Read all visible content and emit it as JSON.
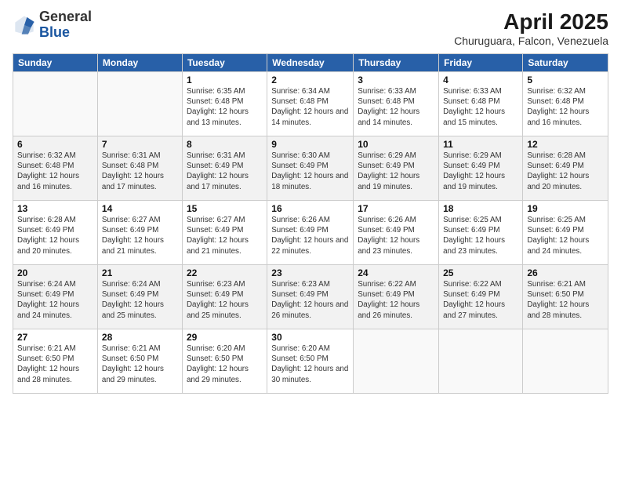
{
  "logo": {
    "general": "General",
    "blue": "Blue"
  },
  "title": {
    "month": "April 2025",
    "location": "Churuguara, Falcon, Venezuela"
  },
  "weekdays": [
    "Sunday",
    "Monday",
    "Tuesday",
    "Wednesday",
    "Thursday",
    "Friday",
    "Saturday"
  ],
  "rows": [
    [
      {
        "day": "",
        "sunrise": "",
        "sunset": "",
        "daylight": ""
      },
      {
        "day": "",
        "sunrise": "",
        "sunset": "",
        "daylight": ""
      },
      {
        "day": "1",
        "sunrise": "Sunrise: 6:35 AM",
        "sunset": "Sunset: 6:48 PM",
        "daylight": "Daylight: 12 hours and 13 minutes."
      },
      {
        "day": "2",
        "sunrise": "Sunrise: 6:34 AM",
        "sunset": "Sunset: 6:48 PM",
        "daylight": "Daylight: 12 hours and 14 minutes."
      },
      {
        "day": "3",
        "sunrise": "Sunrise: 6:33 AM",
        "sunset": "Sunset: 6:48 PM",
        "daylight": "Daylight: 12 hours and 14 minutes."
      },
      {
        "day": "4",
        "sunrise": "Sunrise: 6:33 AM",
        "sunset": "Sunset: 6:48 PM",
        "daylight": "Daylight: 12 hours and 15 minutes."
      },
      {
        "day": "5",
        "sunrise": "Sunrise: 6:32 AM",
        "sunset": "Sunset: 6:48 PM",
        "daylight": "Daylight: 12 hours and 16 minutes."
      }
    ],
    [
      {
        "day": "6",
        "sunrise": "Sunrise: 6:32 AM",
        "sunset": "Sunset: 6:48 PM",
        "daylight": "Daylight: 12 hours and 16 minutes."
      },
      {
        "day": "7",
        "sunrise": "Sunrise: 6:31 AM",
        "sunset": "Sunset: 6:48 PM",
        "daylight": "Daylight: 12 hours and 17 minutes."
      },
      {
        "day": "8",
        "sunrise": "Sunrise: 6:31 AM",
        "sunset": "Sunset: 6:49 PM",
        "daylight": "Daylight: 12 hours and 17 minutes."
      },
      {
        "day": "9",
        "sunrise": "Sunrise: 6:30 AM",
        "sunset": "Sunset: 6:49 PM",
        "daylight": "Daylight: 12 hours and 18 minutes."
      },
      {
        "day": "10",
        "sunrise": "Sunrise: 6:29 AM",
        "sunset": "Sunset: 6:49 PM",
        "daylight": "Daylight: 12 hours and 19 minutes."
      },
      {
        "day": "11",
        "sunrise": "Sunrise: 6:29 AM",
        "sunset": "Sunset: 6:49 PM",
        "daylight": "Daylight: 12 hours and 19 minutes."
      },
      {
        "day": "12",
        "sunrise": "Sunrise: 6:28 AM",
        "sunset": "Sunset: 6:49 PM",
        "daylight": "Daylight: 12 hours and 20 minutes."
      }
    ],
    [
      {
        "day": "13",
        "sunrise": "Sunrise: 6:28 AM",
        "sunset": "Sunset: 6:49 PM",
        "daylight": "Daylight: 12 hours and 20 minutes."
      },
      {
        "day": "14",
        "sunrise": "Sunrise: 6:27 AM",
        "sunset": "Sunset: 6:49 PM",
        "daylight": "Daylight: 12 hours and 21 minutes."
      },
      {
        "day": "15",
        "sunrise": "Sunrise: 6:27 AM",
        "sunset": "Sunset: 6:49 PM",
        "daylight": "Daylight: 12 hours and 21 minutes."
      },
      {
        "day": "16",
        "sunrise": "Sunrise: 6:26 AM",
        "sunset": "Sunset: 6:49 PM",
        "daylight": "Daylight: 12 hours and 22 minutes."
      },
      {
        "day": "17",
        "sunrise": "Sunrise: 6:26 AM",
        "sunset": "Sunset: 6:49 PM",
        "daylight": "Daylight: 12 hours and 23 minutes."
      },
      {
        "day": "18",
        "sunrise": "Sunrise: 6:25 AM",
        "sunset": "Sunset: 6:49 PM",
        "daylight": "Daylight: 12 hours and 23 minutes."
      },
      {
        "day": "19",
        "sunrise": "Sunrise: 6:25 AM",
        "sunset": "Sunset: 6:49 PM",
        "daylight": "Daylight: 12 hours and 24 minutes."
      }
    ],
    [
      {
        "day": "20",
        "sunrise": "Sunrise: 6:24 AM",
        "sunset": "Sunset: 6:49 PM",
        "daylight": "Daylight: 12 hours and 24 minutes."
      },
      {
        "day": "21",
        "sunrise": "Sunrise: 6:24 AM",
        "sunset": "Sunset: 6:49 PM",
        "daylight": "Daylight: 12 hours and 25 minutes."
      },
      {
        "day": "22",
        "sunrise": "Sunrise: 6:23 AM",
        "sunset": "Sunset: 6:49 PM",
        "daylight": "Daylight: 12 hours and 25 minutes."
      },
      {
        "day": "23",
        "sunrise": "Sunrise: 6:23 AM",
        "sunset": "Sunset: 6:49 PM",
        "daylight": "Daylight: 12 hours and 26 minutes."
      },
      {
        "day": "24",
        "sunrise": "Sunrise: 6:22 AM",
        "sunset": "Sunset: 6:49 PM",
        "daylight": "Daylight: 12 hours and 26 minutes."
      },
      {
        "day": "25",
        "sunrise": "Sunrise: 6:22 AM",
        "sunset": "Sunset: 6:49 PM",
        "daylight": "Daylight: 12 hours and 27 minutes."
      },
      {
        "day": "26",
        "sunrise": "Sunrise: 6:21 AM",
        "sunset": "Sunset: 6:50 PM",
        "daylight": "Daylight: 12 hours and 28 minutes."
      }
    ],
    [
      {
        "day": "27",
        "sunrise": "Sunrise: 6:21 AM",
        "sunset": "Sunset: 6:50 PM",
        "daylight": "Daylight: 12 hours and 28 minutes."
      },
      {
        "day": "28",
        "sunrise": "Sunrise: 6:21 AM",
        "sunset": "Sunset: 6:50 PM",
        "daylight": "Daylight: 12 hours and 29 minutes."
      },
      {
        "day": "29",
        "sunrise": "Sunrise: 6:20 AM",
        "sunset": "Sunset: 6:50 PM",
        "daylight": "Daylight: 12 hours and 29 minutes."
      },
      {
        "day": "30",
        "sunrise": "Sunrise: 6:20 AM",
        "sunset": "Sunset: 6:50 PM",
        "daylight": "Daylight: 12 hours and 30 minutes."
      },
      {
        "day": "",
        "sunrise": "",
        "sunset": "",
        "daylight": ""
      },
      {
        "day": "",
        "sunrise": "",
        "sunset": "",
        "daylight": ""
      },
      {
        "day": "",
        "sunrise": "",
        "sunset": "",
        "daylight": ""
      }
    ]
  ]
}
